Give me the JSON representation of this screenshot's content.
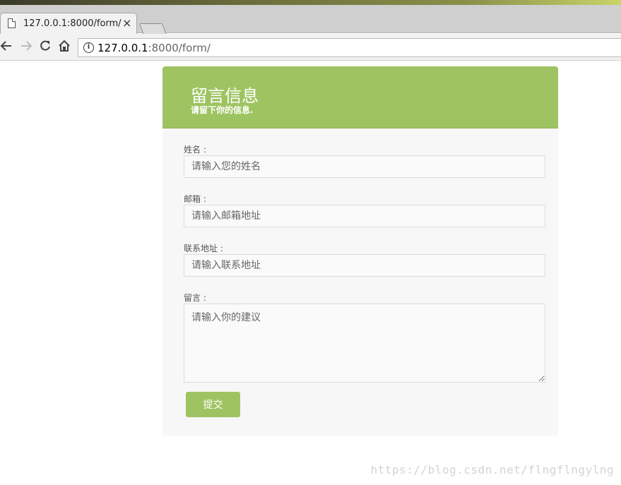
{
  "browser": {
    "tab_title": "127.0.0.1:8000/form/",
    "tab_close": "×",
    "url_host": "127.0.0.1",
    "url_path": ":8000/form/",
    "icons": {
      "back": "arrow-left-icon",
      "forward": "arrow-right-icon",
      "reload": "reload-icon",
      "home": "home-icon",
      "info": "info-icon",
      "page": "page-icon"
    }
  },
  "form": {
    "title": "留言信息",
    "subtitle": "请留下你的信息.",
    "fields": {
      "name": {
        "label": "姓名 :",
        "placeholder": "请输入您的姓名",
        "value": ""
      },
      "email": {
        "label": "邮箱 :",
        "placeholder": "请输入邮箱地址",
        "value": ""
      },
      "address": {
        "label": "联系地址 :",
        "placeholder": "请输入联系地址",
        "value": ""
      },
      "message": {
        "label": "留言 :",
        "placeholder": "请输入你的建议",
        "value": ""
      }
    },
    "submit_label": "提交"
  },
  "watermark": "https://blog.csdn.net/flngflngylng",
  "colors": {
    "accent": "#9ec462",
    "card_bg": "#f7f7f7"
  }
}
